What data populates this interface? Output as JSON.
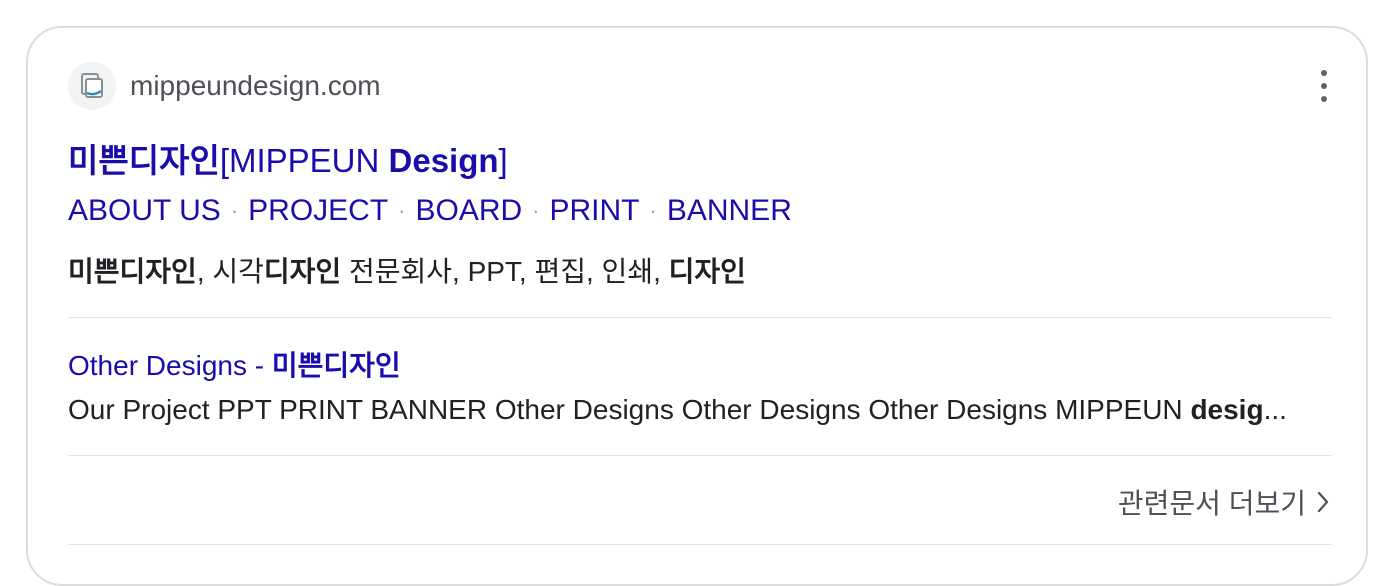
{
  "result": {
    "site_name": "mippeundesign.com",
    "favicon_icon": "document-icon",
    "title_korean": "미쁜디자인",
    "title_bracket_open": "[MIPPEUN ",
    "title_bold": "Design",
    "title_bracket_close": "]",
    "sitelinks": [
      "ABOUT US",
      "PROJECT",
      "BOARD",
      "PRINT",
      "BANNER"
    ],
    "sitelink_separator": "·",
    "description": {
      "part1_bold": "미쁜디자인",
      "part2": ", 시각",
      "part3_bold": "디자인",
      "part4": " 전문회사, PPT, 편집, 인쇄, ",
      "part5_bold": "디자인"
    },
    "sub_result": {
      "title_plain": "Other Designs - ",
      "title_bold": "미쁜디자인",
      "snippet_plain": "Our Project PPT PRINT BANNER Other Designs Other Designs Other Designs MIPPEUN ",
      "snippet_bold": "desig",
      "snippet_ellipsis": "..."
    },
    "more_docs_label": "관련문서 더보기",
    "more_icon": "more-vertical-icon",
    "chevron_icon": "chevron-right-icon"
  },
  "colors": {
    "link": "#1a0dab",
    "text": "#202124",
    "secondary": "#4d5156",
    "border": "#dadce0"
  }
}
